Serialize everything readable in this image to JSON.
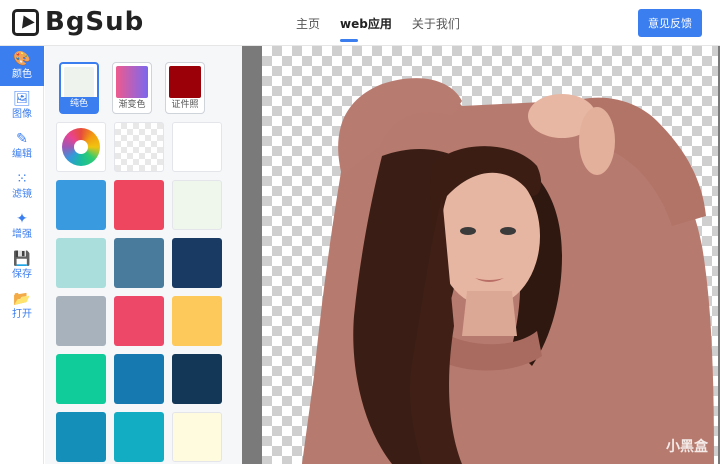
{
  "app": {
    "logo_text": "BgSub"
  },
  "nav": {
    "items": [
      {
        "label": "主页",
        "active": false
      },
      {
        "label": "web应用",
        "active": true
      },
      {
        "label": "关于我们",
        "active": false
      }
    ],
    "feedback_label": "意见反馈"
  },
  "tools": [
    {
      "label": "颜色",
      "icon": "palette-icon",
      "glyph": "🎨",
      "active": true
    },
    {
      "label": "图像",
      "icon": "image-icon",
      "glyph": "🖼",
      "active": false
    },
    {
      "label": "编辑",
      "icon": "pencil-icon",
      "glyph": "✎",
      "active": false
    },
    {
      "label": "滤镜",
      "icon": "dots-grid-icon",
      "glyph": "⁙",
      "active": false
    },
    {
      "label": "增强",
      "icon": "sparkles-icon",
      "glyph": "✦",
      "active": false
    },
    {
      "label": "保存",
      "icon": "save-icon",
      "glyph": "💾",
      "active": false
    },
    {
      "label": "打开",
      "icon": "folder-open-icon",
      "glyph": "📂",
      "active": false
    }
  ],
  "color_tabs": [
    {
      "label": "纯色",
      "color": "#eef3ee",
      "active": true
    },
    {
      "label": "渐变色",
      "gradient": [
        "#ee5a8f",
        "#7b68ee"
      ],
      "active": false
    },
    {
      "label": "证件照",
      "color": "#9b0008",
      "active": false
    }
  ],
  "swatches": [
    {
      "kind": "wheel",
      "name": "color-wheel-icon"
    },
    {
      "kind": "transparent",
      "name": "transparent-swatch"
    },
    {
      "kind": "color",
      "color": "#ffffff"
    },
    {
      "kind": "color",
      "color": "#3a9ae0"
    },
    {
      "kind": "color",
      "color": "#ef4660"
    },
    {
      "kind": "color",
      "color": "#eff6ec"
    },
    {
      "kind": "color",
      "color": "#a9dedc"
    },
    {
      "kind": "color",
      "color": "#487b9c"
    },
    {
      "kind": "color",
      "color": "#193a63"
    },
    {
      "kind": "color",
      "color": "#a8b2bd"
    },
    {
      "kind": "color",
      "color": "#ee4869"
    },
    {
      "kind": "color",
      "color": "#fdc95a"
    },
    {
      "kind": "color",
      "color": "#10cc9a"
    },
    {
      "kind": "color",
      "color": "#167ab1"
    },
    {
      "kind": "color",
      "color": "#133756"
    },
    {
      "kind": "color",
      "color": "#138fba"
    },
    {
      "kind": "color",
      "color": "#12adc2"
    },
    {
      "kind": "color",
      "color": "#fffbde"
    }
  ],
  "watermark": "小黑盒",
  "colors": {
    "accent": "#3b7ef0",
    "canvas_gutter": "#7a7a7a"
  }
}
